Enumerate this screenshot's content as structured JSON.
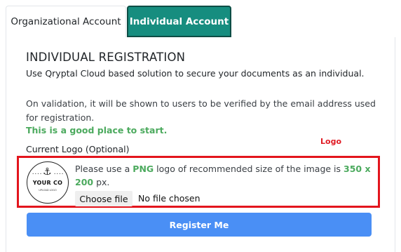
{
  "tabs": {
    "organizational": "Organizational Account",
    "individual": "Individual Account"
  },
  "form": {
    "title": "INDIVIDUAL REGISTRATION",
    "subtitle": "Use Qryptal Cloud based solution to secure your documents as an individual.",
    "note": "On validation, it will be shown to users to be verified by the email address used for registration.",
    "good_place": "This is a good place to start.",
    "logo_label": "Current Logo (Optional)",
    "logo_annotation": "Logo",
    "logo_text": "YOUR CO",
    "logo_small": "UPLOAD LOGO",
    "hint_prefix": "Please use a ",
    "hint_format": "PNG",
    "hint_mid": " logo of recommended size of the image is ",
    "hint_size": "350 x 200",
    "hint_suffix": " px.",
    "choose_file": "Choose file",
    "file_status": "No file chosen",
    "register": "Register Me"
  },
  "colors": {
    "tab_active": "#168d7f",
    "highlight": "#e3151d",
    "accent_green": "#4caa5e",
    "button": "#4a8ff5"
  }
}
